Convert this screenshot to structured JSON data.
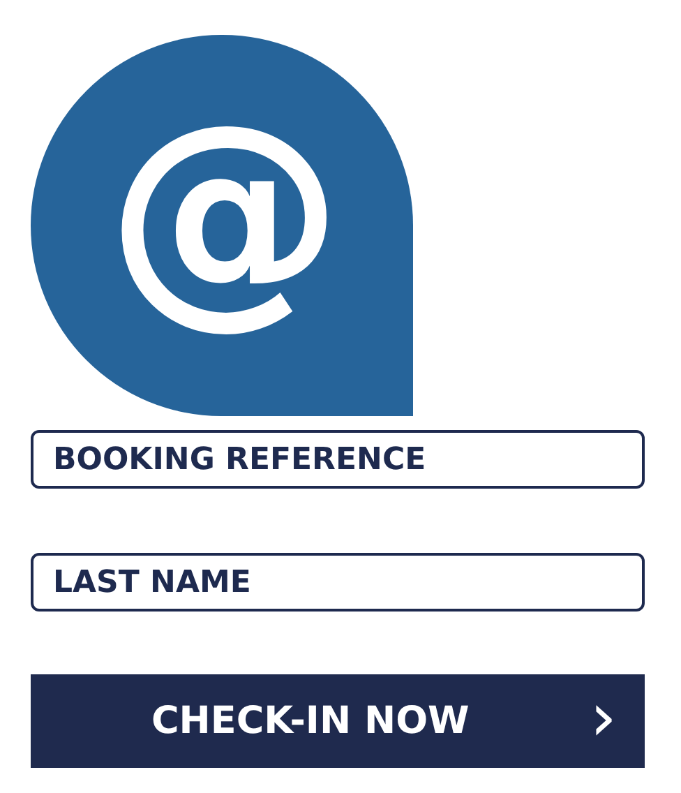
{
  "logo": {
    "symbol": "@"
  },
  "fields": [
    {
      "placeholder": "BOOKING REFERENCE"
    },
    {
      "placeholder": "LAST NAME"
    }
  ],
  "button": {
    "label": "CHECK-IN NOW",
    "arrow": "›"
  }
}
